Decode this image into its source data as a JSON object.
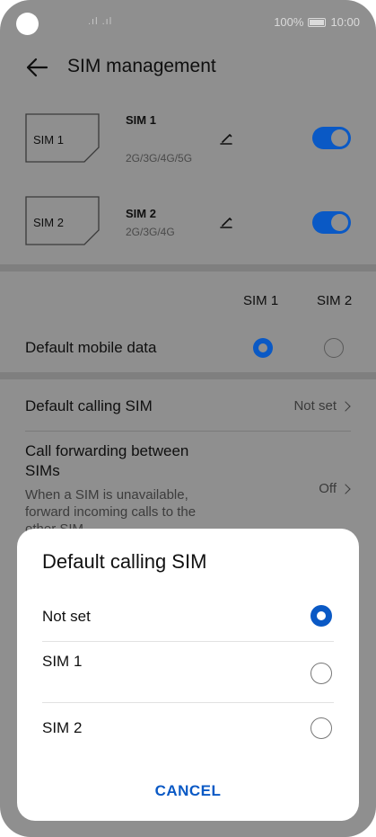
{
  "status_bar": {
    "signal": ".ıl .ıl",
    "battery": "100%",
    "time": "10:00"
  },
  "header": {
    "title": "SIM management"
  },
  "sims": [
    {
      "card_label": "SIM 1",
      "name": "SIM 1",
      "network": "2G/3G/4G/5G",
      "enabled": true
    },
    {
      "card_label": "SIM 2",
      "name": "SIM 2",
      "network": "2G/3G/4G",
      "enabled": true
    }
  ],
  "columns": {
    "sim1": "SIM 1",
    "sim2": "SIM 2"
  },
  "default_mobile_data": {
    "label": "Default mobile data",
    "selected": "SIM 1"
  },
  "default_calling": {
    "label": "Default calling SIM",
    "value": "Not set"
  },
  "call_forwarding": {
    "label_line1": "Call forwarding between",
    "label_line2": "SIMs",
    "desc_line1": "When a SIM is unavailable,",
    "desc_line2": "forward incoming calls to the",
    "desc_line3": "other SIM",
    "value": "Off"
  },
  "dialog": {
    "title": "Default calling SIM",
    "options": [
      {
        "label": "Not set",
        "selected": true
      },
      {
        "label": "SIM 1",
        "selected": false
      },
      {
        "label": "SIM 2",
        "selected": false
      }
    ],
    "cancel_label": "CANCEL"
  },
  "colors": {
    "accent": "#0a59c5",
    "scrim": "#8f8f8f"
  }
}
